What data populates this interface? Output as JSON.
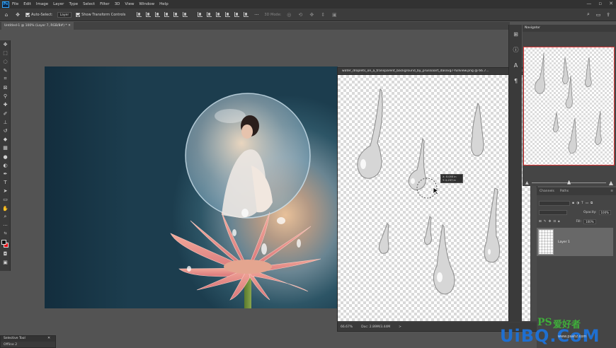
{
  "menubar": {
    "logo": "Ps",
    "items": [
      "File",
      "Edit",
      "Image",
      "Layer",
      "Type",
      "Select",
      "Filter",
      "3D",
      "View",
      "Window",
      "Help"
    ]
  },
  "options": {
    "auto_select_label": "Auto-Select:",
    "target": "Layer",
    "transform_label": "Show Transform Controls",
    "mode_3d_label": "3D Mode:"
  },
  "document": {
    "tab": "Untitled-1 @ 100% (Layer 7, RGB/8#) *"
  },
  "float_window": {
    "title": "water_droplets_on_a_transparent_background_by_prussiaart_dassvg7-fullview.png @ 66.7...",
    "zoom": "66.67%",
    "doc_info": "Doc: 2.89M/3.44M",
    "arrow": ">"
  },
  "tooltip": {
    "x": "X:  0.050 in",
    "y": "Y:  0.237 in"
  },
  "navigator": {
    "title": "Navigator"
  },
  "layers": {
    "tabs": [
      "Channels",
      "Paths"
    ],
    "opacity_label": "Opacity:",
    "opacity_value": "100%",
    "fill_label": "Fill:",
    "fill_value": "100%",
    "layer_name": "Layer 1"
  },
  "selective": {
    "title": "Selective Tool",
    "item": "Offline 2"
  },
  "watermark": {
    "ps": "PS",
    "cn": "爱好者",
    "site": "UiBQ.CoM",
    "url": "www.psahz.com"
  },
  "colors": {
    "foreground": "#111111",
    "background": "#e3000f",
    "accent": "#31a8ff"
  }
}
